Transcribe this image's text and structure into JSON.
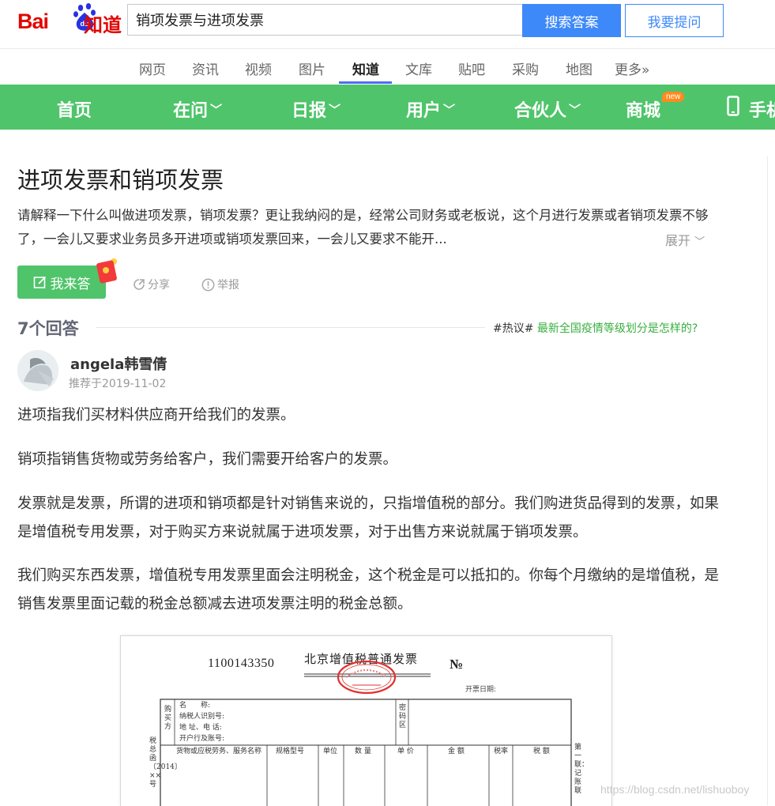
{
  "header": {
    "logo_text_bai": "Bai",
    "logo_text_du": "du",
    "logo_text_zhidao": "知道",
    "search_value": "销项发票与进项发票",
    "search_button": "搜索答案",
    "ask_button": "我要提问"
  },
  "channels": [
    {
      "label": "网页"
    },
    {
      "label": "资讯"
    },
    {
      "label": "视频"
    },
    {
      "label": "图片"
    },
    {
      "label": "知道"
    },
    {
      "label": "文库"
    },
    {
      "label": "贴吧"
    },
    {
      "label": "采购"
    },
    {
      "label": "地图"
    },
    {
      "label": "更多»"
    }
  ],
  "greenbar": {
    "home": "首页",
    "zaiwen": "在问",
    "ribao": "日报",
    "yonghu": "用户",
    "hehuoren": "合伙人",
    "shangcheng": "商城",
    "new_badge": "new",
    "shouji": "手机"
  },
  "question": {
    "title": "进项发票和销项发票",
    "description": "请解释一下什么叫做进项发票，销项发票？更让我纳闷的是，经常公司财务或老板说，这个月进行发票或者销项发票不够了，一会儿又要求业务员多开进项或销项发票回来，一会儿又要求不能开...",
    "expand": "展开"
  },
  "actions": {
    "answer_button": "我来答",
    "share": "分享",
    "report": "举报"
  },
  "answers_header": {
    "count": "7个回答",
    "hot_tag": "#热议#",
    "hot_link": "最新全国疫情等级划分是怎样的?"
  },
  "answer": {
    "author": "angela韩雪倩",
    "date": "推荐于2019-11-02",
    "p1": "进项指我们买材料供应商开给我们的发票。",
    "p2": "销项指销售货物或劳务给客户，我们需要开给客户的发票。",
    "p3": "发票就是发票，所谓的进项和销项都是针对销售来说的，只指增值税的部分。我们购进货品得到的发票，如果是增值税专用发票，对于购买方来说就属于进项发票，对于出售方来说就属于销项发票。",
    "p4": "我们购买东西发票，增值税专用发票里面会注明税金，这个税金是可以抵扣的。你每个月缴纳的是增值税，是销售发票里面记载的税金总额减去进项发票注明的税金总额。"
  },
  "invoice": {
    "number": "1100143350",
    "title": "北京增值税普通发票",
    "no_mark": "№",
    "date_label": "开票日期:",
    "buyer": "购买方",
    "name": "名　　称:",
    "taxid": "纳税人识别号:",
    "address": "地 址、电 话:",
    "bank": "开户行及账号:",
    "password_area": "密码区",
    "col_goods": "货物或应税劳务、服务名称",
    "col_spec": "规格型号",
    "col_unit": "单位",
    "col_qty": "数 量",
    "col_price": "单 价",
    "col_amount": "金 额",
    "col_rate": "税率",
    "col_tax": "税 额",
    "side_right": "第一联：记账联",
    "side_left": "税总函〔2014〕××号"
  },
  "watermark": "https://blog.csdn.net/lishuoboy"
}
